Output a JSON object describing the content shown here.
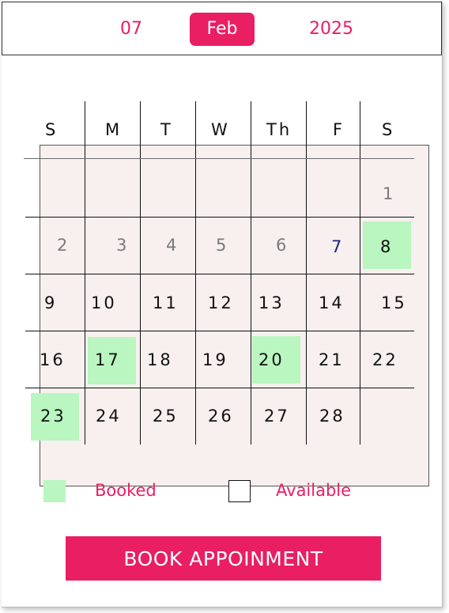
{
  "header": {
    "day": "07",
    "month": "Feb",
    "year": "2025"
  },
  "weekdays": [
    "S",
    "M",
    "T",
    "W",
    "Th",
    "F",
    "S"
  ],
  "days": {
    "d1": "1",
    "d2": "2",
    "d3": "3",
    "d4": "4",
    "d5": "5",
    "d6": "6",
    "d7": "7",
    "d8": "8",
    "d9": "9",
    "d10": "10",
    "d11": "11",
    "d12": "12",
    "d13": "13",
    "d14": "14",
    "d15": "15",
    "d16": "16",
    "d17": "17",
    "d18": "18",
    "d19": "19",
    "d20": "20",
    "d21": "21",
    "d22": "22",
    "d23": "23",
    "d24": "24",
    "d25": "25",
    "d26": "26",
    "d27": "27",
    "d28": "28"
  },
  "booked_days": [
    "8",
    "17",
    "20",
    "23"
  ],
  "legend": {
    "booked": "Booked",
    "available": "Available"
  },
  "button": {
    "label": "BOOK APPOINMENT"
  },
  "colors": {
    "accent": "#e91e63",
    "booked": "#b9f6c0",
    "calendar_bg": "#f7f0ee",
    "today": "#1a237e"
  }
}
